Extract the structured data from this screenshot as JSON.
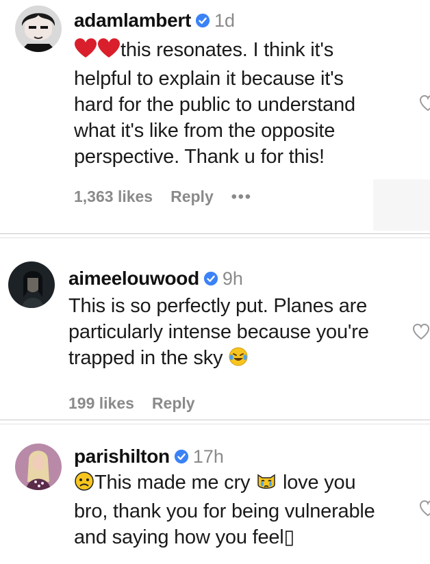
{
  "colors": {
    "verified": "#3b82f6",
    "heart_red": "#d91f2b",
    "muted": "#8a8a8a"
  },
  "comments": [
    {
      "username": "adamlambert",
      "time": "1d",
      "lead_emoji": "red-heart-icon red-heart-icon",
      "lines": [
        "this resonates. I think it's",
        "helpful to explain it because it's",
        "hard for the public to understand",
        "what it's like from the opposite",
        "perspective. Thank u for this!"
      ],
      "likes": "1,363 likes",
      "reply": "Reply",
      "more": "•••"
    },
    {
      "username": "aimeelouwood",
      "time": "9h",
      "lines": [
        "This is so perfectly put. Planes are",
        "particularly intense because you're",
        "trapped in the sky"
      ],
      "trailing_emoji": "laughing-tears-icon",
      "likes": "199 likes",
      "reply": "Reply"
    },
    {
      "username": "parishilton",
      "time": "17h",
      "lines": [
        "This made me cry",
        "love you",
        "bro, thank you for being vulnerable",
        "and saying how you feel▯"
      ],
      "emojis": [
        "sad-face-icon",
        "crying-cat-icon"
      ]
    }
  ]
}
